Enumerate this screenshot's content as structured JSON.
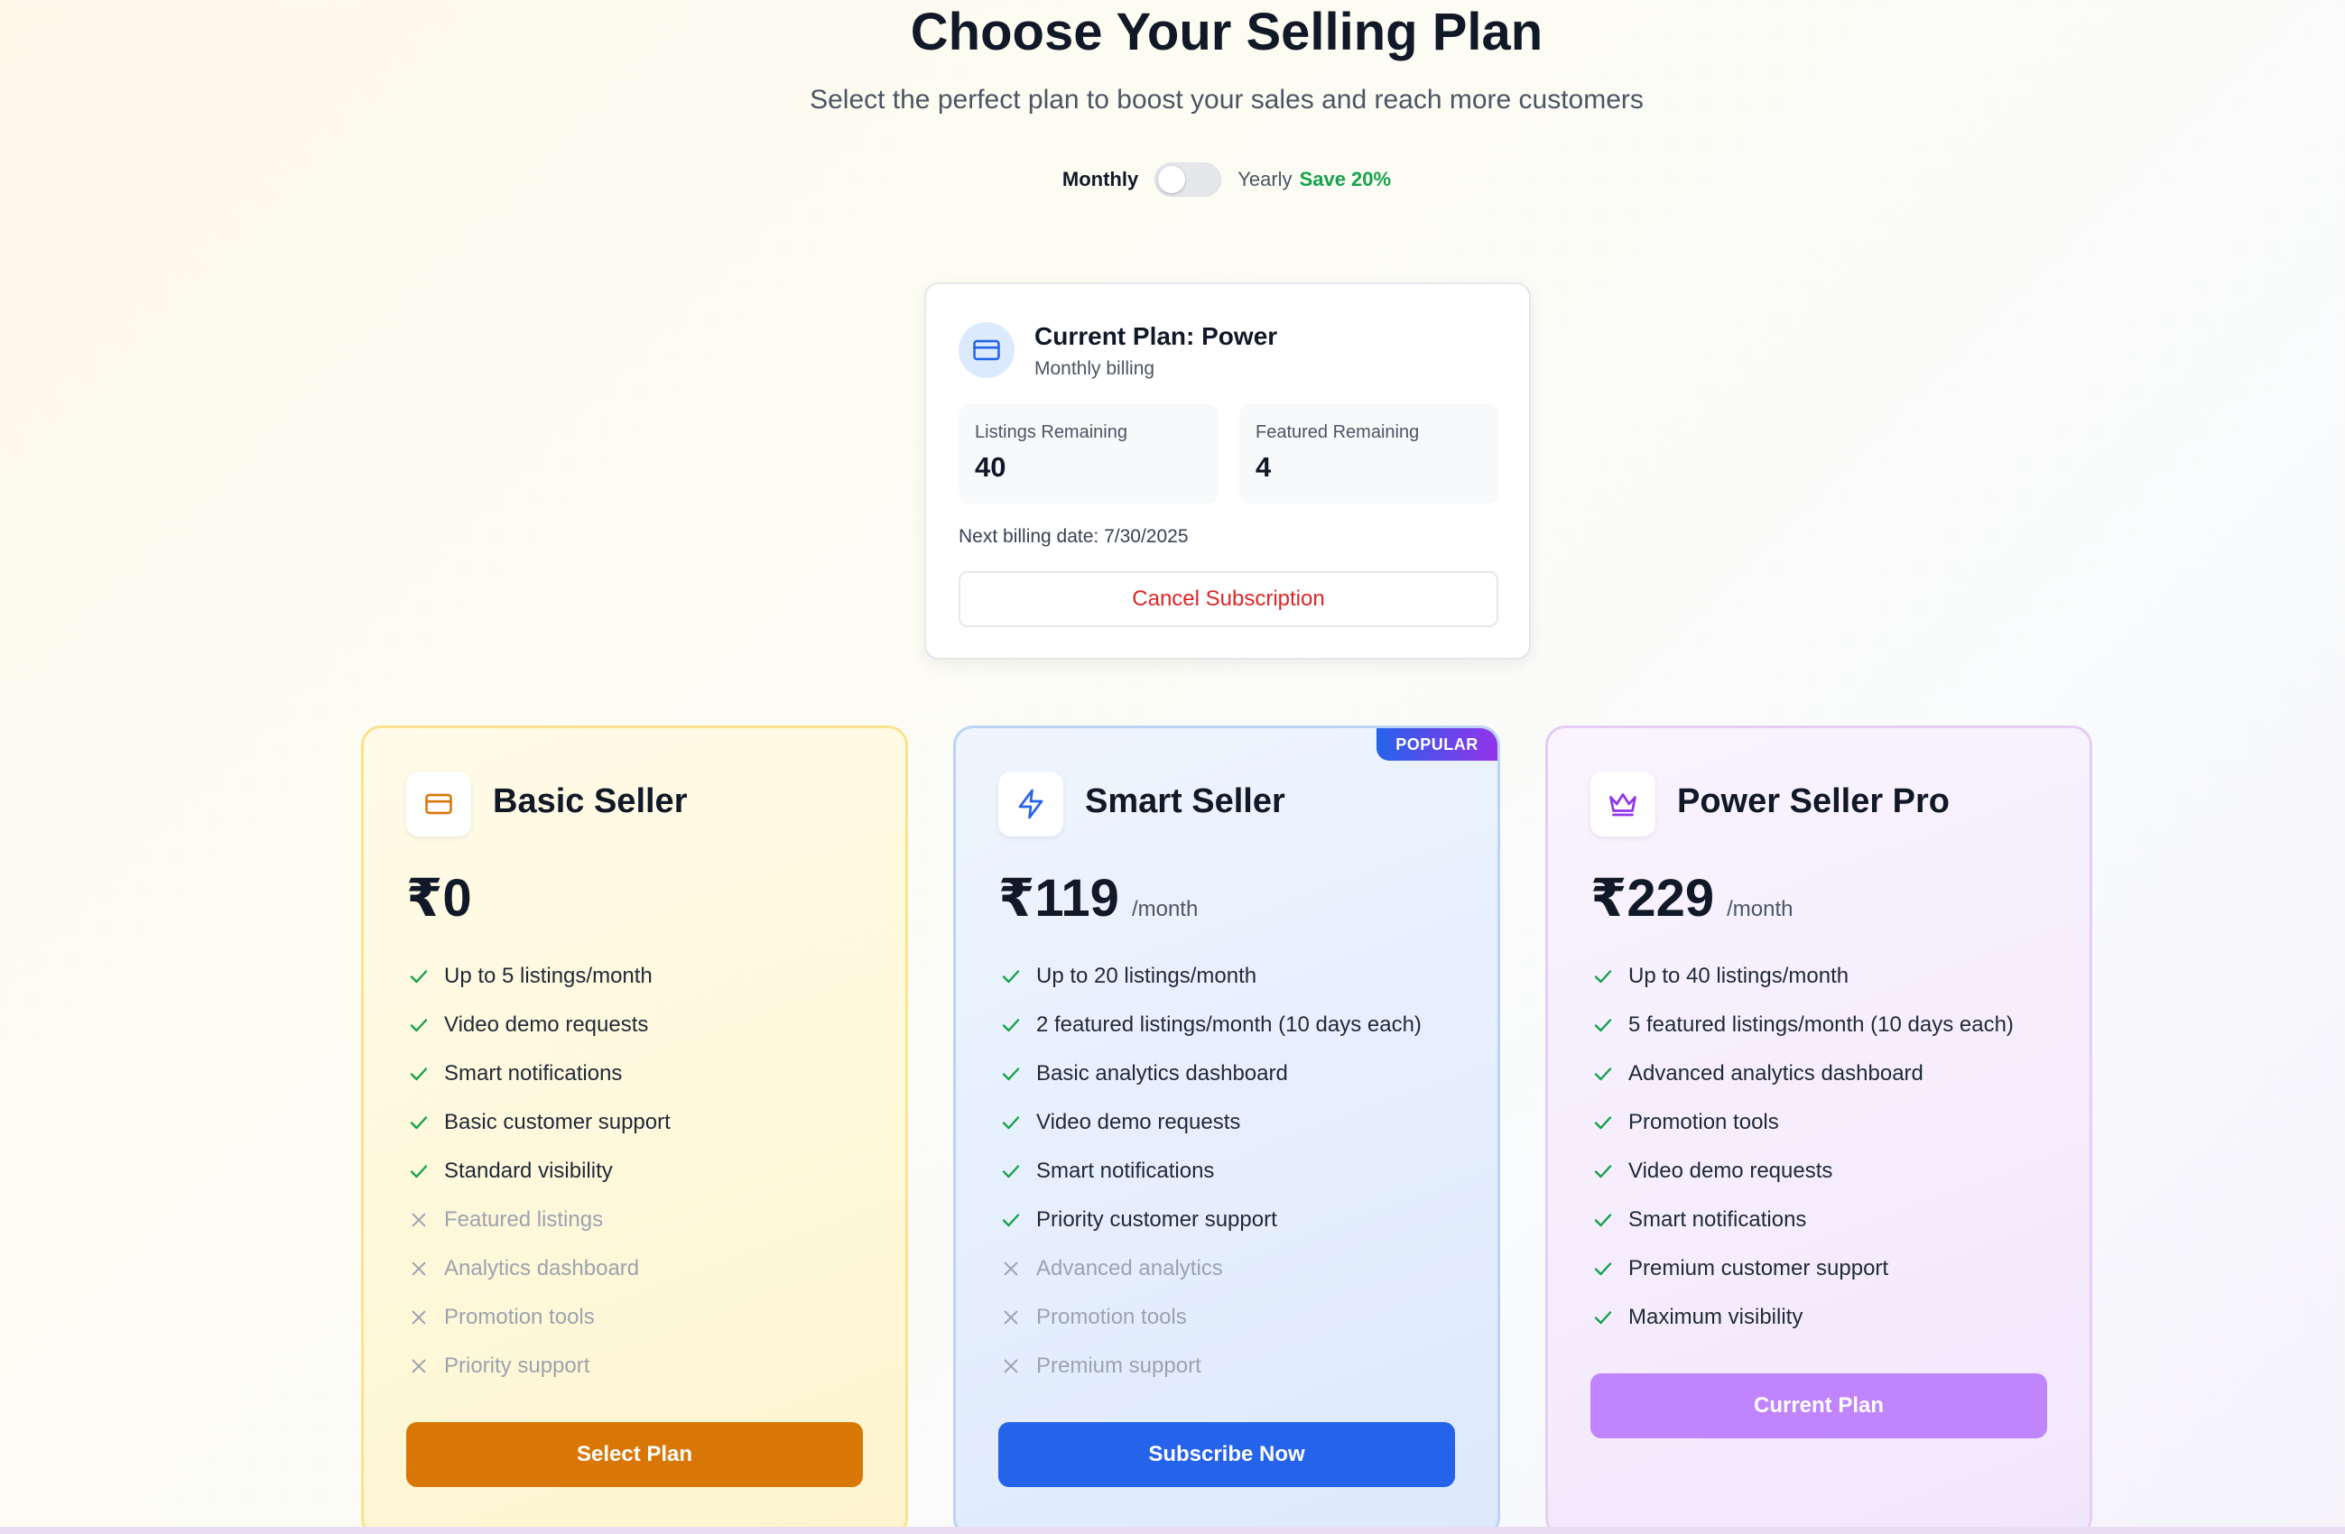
{
  "header": {
    "title": "Choose Your Selling Plan",
    "subtitle": "Select the perfect plan to boost your sales and reach more customers"
  },
  "billing_toggle": {
    "monthly_label": "Monthly",
    "yearly_label": "Yearly",
    "save_label": "Save 20%",
    "selected": "Monthly"
  },
  "current_plan": {
    "title": "Current Plan: Power",
    "billing": "Monthly billing",
    "listings_label": "Listings Remaining",
    "listings_value": "40",
    "featured_label": "Featured Remaining",
    "featured_value": "4",
    "next_billing": "Next billing date: 7/30/2025",
    "cancel_label": "Cancel Subscription",
    "icon": "credit-card-icon"
  },
  "plans": [
    {
      "name": "Basic Seller",
      "icon": "credit-card-icon",
      "price": "₹0",
      "period": "",
      "accent": "#d97706",
      "features": [
        {
          "text": "Up to 5 listings/month",
          "included": true
        },
        {
          "text": "Video demo requests",
          "included": true
        },
        {
          "text": "Smart notifications",
          "included": true
        },
        {
          "text": "Basic customer support",
          "included": true
        },
        {
          "text": "Standard visibility",
          "included": true
        },
        {
          "text": "Featured listings",
          "included": false
        },
        {
          "text": "Analytics dashboard",
          "included": false
        },
        {
          "text": "Promotion tools",
          "included": false
        },
        {
          "text": "Priority support",
          "included": false
        }
      ],
      "cta": "Select Plan"
    },
    {
      "name": "Smart Seller",
      "icon": "lightning-icon",
      "price": "₹119",
      "period": "/month",
      "badge": "POPULAR",
      "accent": "#2563eb",
      "features": [
        {
          "text": "Up to 20 listings/month",
          "included": true
        },
        {
          "text": "2 featured listings/month (10 days each)",
          "included": true
        },
        {
          "text": "Basic analytics dashboard",
          "included": true
        },
        {
          "text": "Video demo requests",
          "included": true
        },
        {
          "text": "Smart notifications",
          "included": true
        },
        {
          "text": "Priority customer support",
          "included": true
        },
        {
          "text": "Advanced analytics",
          "included": false
        },
        {
          "text": "Promotion tools",
          "included": false
        },
        {
          "text": "Premium support",
          "included": false
        }
      ],
      "cta": "Subscribe Now"
    },
    {
      "name": "Power Seller Pro",
      "icon": "crown-icon",
      "price": "₹229",
      "period": "/month",
      "accent": "#c084fc",
      "features": [
        {
          "text": "Up to 40 listings/month",
          "included": true
        },
        {
          "text": "5 featured listings/month (10 days each)",
          "included": true
        },
        {
          "text": "Advanced analytics dashboard",
          "included": true
        },
        {
          "text": "Promotion tools",
          "included": true
        },
        {
          "text": "Video demo requests",
          "included": true
        },
        {
          "text": "Smart notifications",
          "included": true
        },
        {
          "text": "Premium customer support",
          "included": true
        },
        {
          "text": "Maximum visibility",
          "included": true
        }
      ],
      "cta": "Current Plan"
    }
  ],
  "colors": {
    "check": "#16a34a",
    "cross": "#9ca3af",
    "danger": "#dc2626",
    "save": "#16a34a"
  }
}
